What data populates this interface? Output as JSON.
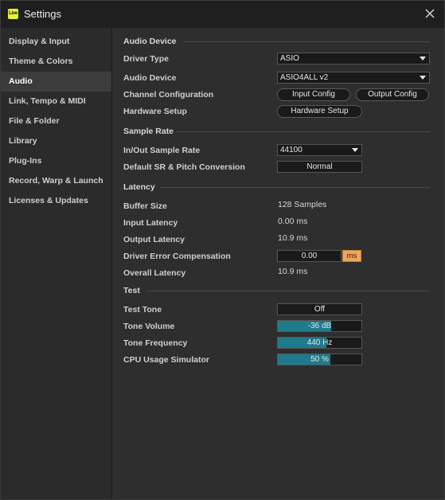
{
  "window": {
    "title": "Settings",
    "logo_text": "Live"
  },
  "sidebar": {
    "items": [
      {
        "label": "Display & Input"
      },
      {
        "label": "Theme & Colors"
      },
      {
        "label": "Audio",
        "active": true
      },
      {
        "label": "Link, Tempo & MIDI"
      },
      {
        "label": "File & Folder"
      },
      {
        "label": "Library"
      },
      {
        "label": "Plug-Ins"
      },
      {
        "label": "Record, Warp & Launch"
      },
      {
        "label": "Licenses & Updates"
      }
    ]
  },
  "audio_device": {
    "heading": "Audio Device",
    "driver_type_label": "Driver Type",
    "driver_type_value": "ASIO",
    "audio_device_label": "Audio Device",
    "audio_device_value": "ASIO4ALL v2",
    "channel_config_label": "Channel Configuration",
    "input_config_label": "Input Config",
    "output_config_label": "Output Config",
    "hardware_setup_label": "Hardware Setup",
    "hardware_setup_button": "Hardware Setup"
  },
  "sample_rate": {
    "heading": "Sample Rate",
    "io_rate_label": "In/Out Sample Rate",
    "io_rate_value": "44100",
    "default_sr_label": "Default SR & Pitch Conversion",
    "default_sr_value": "Normal"
  },
  "latency": {
    "heading": "Latency",
    "buffer_size_label": "Buffer Size",
    "buffer_size_value": "128 Samples",
    "input_latency_label": "Input Latency",
    "input_latency_value": "0.00 ms",
    "output_latency_label": "Output Latency",
    "output_latency_value": "10.9 ms",
    "driver_error_label": "Driver Error Compensation",
    "driver_error_value": "0.00",
    "driver_error_unit": "ms",
    "overall_latency_label": "Overall Latency",
    "overall_latency_value": "10.9 ms"
  },
  "test": {
    "heading": "Test",
    "test_tone_label": "Test Tone",
    "test_tone_value": "Off",
    "tone_volume_label": "Tone Volume",
    "tone_volume_value": "-36 dB",
    "tone_volume_fill": 0.64,
    "tone_frequency_label": "Tone Frequency",
    "tone_frequency_value": "440 Hz",
    "tone_frequency_fill": 0.58,
    "cpu_sim_label": "CPU Usage Simulator",
    "cpu_sim_value": "50 %",
    "cpu_sim_fill": 0.63
  },
  "colors": {
    "accent_fill": "#1f7a8c",
    "ms_tag": "#f0a35a",
    "logo": "#e3f33a"
  }
}
